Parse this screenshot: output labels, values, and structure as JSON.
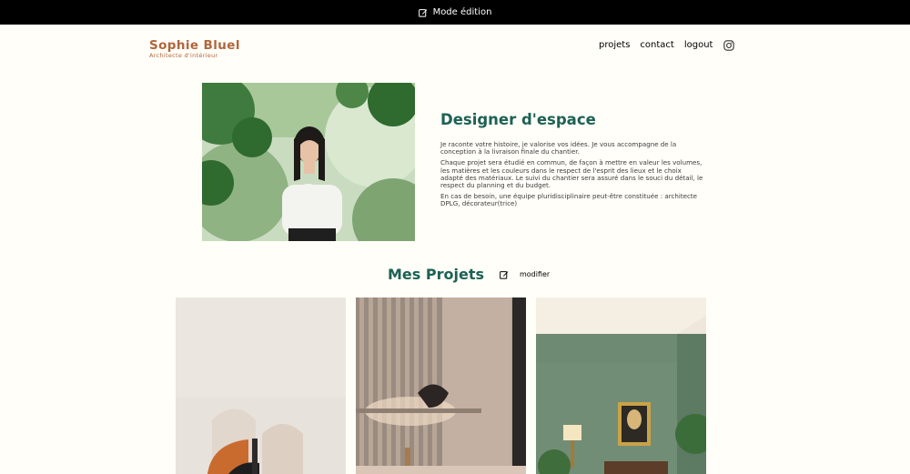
{
  "edit_bar": {
    "label": "Mode édition",
    "icon": "edit-icon"
  },
  "header": {
    "brand_name": "Sophie Bluel",
    "brand_subtitle": "Architecte d'intérieur",
    "nav": [
      {
        "label": "projets"
      },
      {
        "label": "contact"
      },
      {
        "label": "logout"
      }
    ],
    "social_icon": "instagram-icon"
  },
  "intro": {
    "title": "Designer d'espace",
    "paragraphs": [
      "Je raconte votre histoire, je valorise vos idées. Je vous accompagne de la conception à la livraison finale du chantier.",
      "Chaque projet sera étudié en commun, de façon à mettre en valeur les volumes, les matières et les couleurs dans le respect de l'esprit des lieux et le choix adapté des matériaux. Le suivi du chantier sera assuré dans le souci du détail, le respect du planning et du budget.",
      "En cas de besoin, une équipe pluridisciplinaire peut-être constituée : architecte DPLG, décorateur(trice)"
    ]
  },
  "projects": {
    "title": "Mes Projets",
    "edit_label": "modifier"
  },
  "colors": {
    "accent_green": "#1D6154",
    "brand_orange": "#B1663C",
    "background": "#FFFEF8",
    "edit_bar": "#000000"
  }
}
